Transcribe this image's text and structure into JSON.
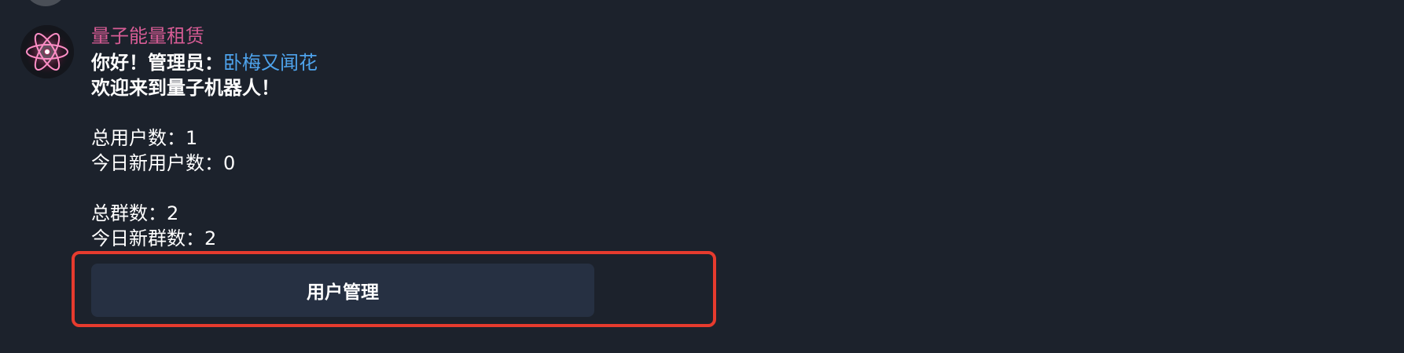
{
  "message": {
    "sender": "量子能量租赁",
    "greeting_prefix": "你好！管理员：",
    "admin_name": "卧梅又闻花",
    "welcome": "欢迎来到量子机器人！",
    "total_users": "总用户数：1",
    "new_users_today": "今日新用户数：0",
    "total_groups": "总群数：2",
    "new_groups_today": "今日新群数：2"
  },
  "buttons": {
    "user_management": "用户管理"
  },
  "colors": {
    "background": "#1c222c",
    "sender": "#d75c95",
    "link": "#4ea3ec",
    "button_bg": "#263042",
    "highlight": "#e63b2e"
  }
}
